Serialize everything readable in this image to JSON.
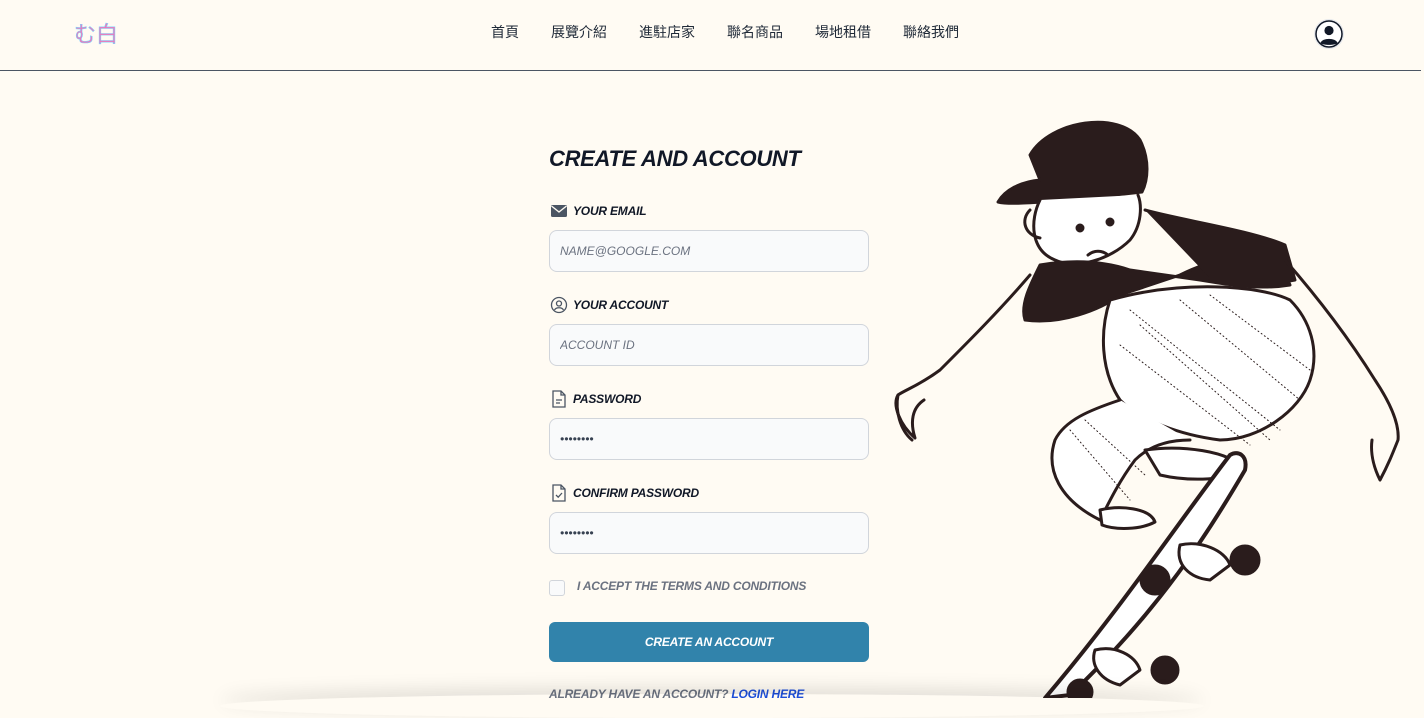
{
  "header": {
    "logo_text": "む白",
    "nav": [
      {
        "label": "首頁"
      },
      {
        "label": "展覽介紹"
      },
      {
        "label": "進駐店家"
      },
      {
        "label": "聯名商品"
      },
      {
        "label": "場地租借"
      },
      {
        "label": "聯絡我們"
      }
    ],
    "avatar_icon": "user-circle-icon"
  },
  "form": {
    "title": "CREATE AND ACCOUNT",
    "email": {
      "label": "YOUR EMAIL",
      "placeholder": "NAME@GOOGLE.COM",
      "icon": "envelope-icon"
    },
    "account": {
      "label": "YOUR ACCOUNT",
      "placeholder": "ACCOUNT ID",
      "icon": "user-circle-outline-icon"
    },
    "password": {
      "label": "PASSWORD",
      "value": "••••••••",
      "icon": "document-icon"
    },
    "confirm_password": {
      "label": "CONFIRM PASSWORD",
      "value": "••••••••",
      "icon": "document-check-icon"
    },
    "terms_label": "I ACCEPT THE TERMS AND CONDITIONS",
    "submit_label": "CREATE AN ACCOUNT",
    "login_prompt": "ALREADY HAVE AN ACCOUNT?",
    "login_link": "LOGIN HERE"
  },
  "colors": {
    "background": "#fffbf3",
    "button": "#3183ab",
    "logo_pink": "#f472b6",
    "logo_blue": "#7dd3fc"
  }
}
